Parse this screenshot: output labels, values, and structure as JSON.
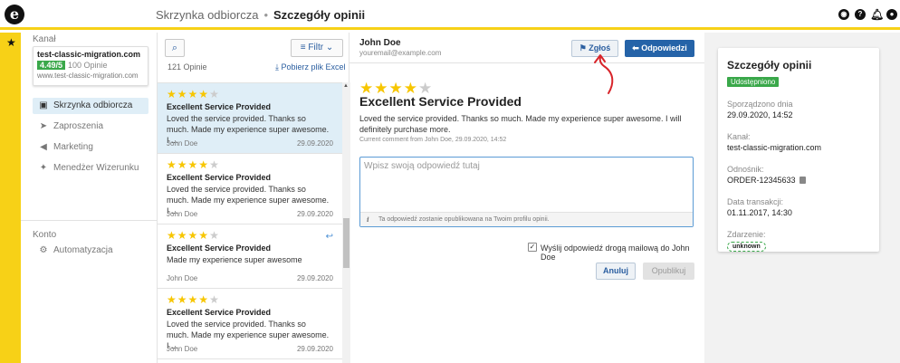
{
  "topbar": {
    "logo_letter": "e",
    "breadcrumb_parent": "Skrzynka odbiorcza",
    "breadcrumb_separator": "•",
    "breadcrumb_current": "Szczegóły opinii",
    "icons": [
      "profile-circle-icon",
      "help-icon",
      "bell-icon",
      "user-icon"
    ]
  },
  "sidebar_strip": {
    "star": "★"
  },
  "left_nav": {
    "channel_label": "Kanał",
    "channel": {
      "name": "test-classic-migration.com",
      "rating": "4.49/5",
      "reviews": "100 Opinie",
      "url": "www.test-classic-migration.com"
    },
    "items": [
      {
        "label": "Skrzynka odbiorcza",
        "icon": "inbox-icon",
        "active": true
      },
      {
        "label": "Zaproszenia",
        "icon": "send-icon",
        "active": false
      },
      {
        "label": "Marketing",
        "icon": "megaphone-icon",
        "active": false
      },
      {
        "label": "Menedżer Wizerunku",
        "icon": "sparkle-icon",
        "active": false
      }
    ],
    "account_label": "Konto",
    "account_items": [
      {
        "label": "Automatyzacja",
        "icon": "robot-icon"
      }
    ]
  },
  "list": {
    "filter_label": "Filtr",
    "count_label": "121 Opinie",
    "download_label": "Pobierz plik Excel",
    "reviews": [
      {
        "rating": 3.5,
        "title": "Excellent Service Provided",
        "body": "Loved the service provided. Thanks so much. Made my experience super awesome. I ...",
        "author": "John Doe",
        "date": "29.09.2020",
        "selected": true,
        "replied": false
      },
      {
        "rating": 3.5,
        "title": "Excellent Service Provided",
        "body": "Loved the service provided. Thanks so much. Made my experience super awesome. I ...",
        "author": "John Doe",
        "date": "29.09.2020",
        "selected": false,
        "replied": false
      },
      {
        "rating": 3.5,
        "title": "Excellent Service Provided",
        "body": "Made my experience super awesome",
        "author": "John Doe",
        "date": "29.09.2020",
        "selected": false,
        "replied": true
      },
      {
        "rating": 3.5,
        "title": "Excellent Service Provided",
        "body": "Loved the service provided. Thanks so much. Made my experience super awesome. I ...",
        "author": "John Doe",
        "date": "29.09.2020",
        "selected": false,
        "replied": false
      }
    ]
  },
  "detail": {
    "name": "John Doe",
    "email": "youremail@example.com",
    "report_label": "Zgłoś",
    "reply_label": "Odpowiedzi",
    "rating": 3.5,
    "title": "Excellent Service Provided",
    "body": "Loved the service provided. Thanks so much. Made my experience super awesome. I will definitely purchase more.",
    "current_comment": "Current comment from John Doe, 29.09.2020, 14:52",
    "reply_placeholder": "Wpisz swoją odpowiedź tutaj",
    "reply_note": "Ta odpowiedź zostanie opublikowana na Twoim profilu opinii.",
    "email_checkbox_checked": true,
    "email_checkbox_label": "Wyślij odpowiedź drogą mailową do John Doe",
    "cancel_label": "Anuluj",
    "publish_label": "Opublikuj"
  },
  "info_card": {
    "title": "Szczegóły opinii",
    "status": "Udostępniono",
    "created_label": "Sporządzono dnia",
    "created_value": "29.09.2020, 14:52",
    "channel_label": "Kanał:",
    "channel_value": "test-classic-migration.com",
    "reference_label": "Odnośnik:",
    "reference_value": "ORDER-12345633",
    "transaction_label": "Data transakcji:",
    "transaction_value": "01.11.2017, 14:30",
    "event_label": "Zdarzenie:",
    "event_value": "unknown"
  },
  "colors": {
    "accent_yellow": "#f7d117",
    "primary_blue": "#2563a8",
    "green": "#3aa84a",
    "selected_bg": "#dfeef7",
    "annotation_red": "#d8242a"
  }
}
